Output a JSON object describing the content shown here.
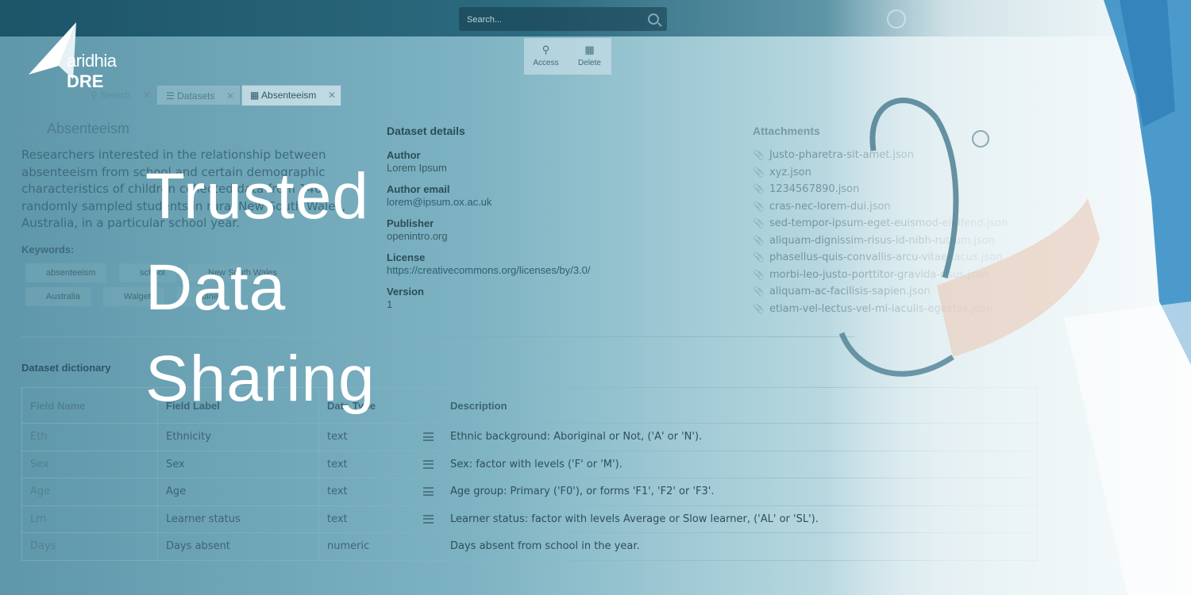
{
  "brand": {
    "logo_text_light": "aridhia",
    "logo_text_bold": "DRE"
  },
  "search": {
    "placeholder": "Search..."
  },
  "toolbar": {
    "access_label": "Access",
    "delete_label": "Delete"
  },
  "tabs": [
    {
      "label": "Search",
      "icon": "search-icon"
    },
    {
      "label": "Datasets",
      "icon": "database-icon"
    },
    {
      "label": "Absenteeism",
      "icon": "table-icon",
      "active": true
    }
  ],
  "dataset": {
    "title": "Absenteeism",
    "description": "Researchers interested in the relationship between absenteeism from school and certain demographic characteristics of children collected data from 146 randomly sampled students in rural New South Wales, Australia, in a particular school year.",
    "keywords_label": "Keywords:",
    "keywords": [
      "absenteeism",
      "school",
      "New South Wales",
      "Australia",
      "Walgett",
      "quine"
    ]
  },
  "details": {
    "title": "Dataset details",
    "author_label": "Author",
    "author": "Lorem Ipsum",
    "email_label": "Author email",
    "email": "lorem@ipsum.ox.ac.uk",
    "publisher_label": "Publisher",
    "publisher": "openintro.org",
    "license_label": "License",
    "license": "https://creativecommons.org/licenses/by/3.0/",
    "version_label": "Version",
    "version": "1"
  },
  "attachments": {
    "title": "Attachments",
    "files": [
      "Justo-pharetra-sit-amet.json",
      "xyz.json",
      "1234567890.json",
      "cras-nec-lorem-dui.json",
      "sed-tempor-ipsum-eget-euismod-eleifend.json",
      "aliquam-dignissim-risus-id-nibh-rutrum.json",
      "phasellus-quis-convallis-arcu-vitae-lacus.json",
      "morbi-leo-justo-porttitor-gravida-risus.json",
      "aliquam-ac-facilisis-sapien.json",
      "etiam-vel-lectus-vel-mi-iaculis-egestas.json"
    ]
  },
  "dictionary": {
    "title": "Dataset dictionary",
    "headers": [
      "Field Name",
      "Field Label",
      "Data Type",
      "Description"
    ],
    "rows": [
      {
        "name": "Eth",
        "label": "Ethnicity",
        "type": "text",
        "desc": "Ethnic background: Aboriginal or Not, ('A' or 'N')."
      },
      {
        "name": "Sex",
        "label": "Sex",
        "type": "text",
        "desc": "Sex: factor with levels ('F' or 'M')."
      },
      {
        "name": "Age",
        "label": "Age",
        "type": "text",
        "desc": "Age group: Primary ('F0'), or forms 'F1', 'F2' or 'F3'."
      },
      {
        "name": "Lrn",
        "label": "Learner status",
        "type": "text",
        "desc": "Learner status: factor with levels Average or Slow learner, ('AL' or 'SL')."
      },
      {
        "name": "Days",
        "label": "Days absent",
        "type": "numeric",
        "desc": "Days absent from school in the year."
      }
    ]
  },
  "hero": {
    "line1": "Trusted",
    "line2": "Data",
    "line3": "Sharing"
  }
}
